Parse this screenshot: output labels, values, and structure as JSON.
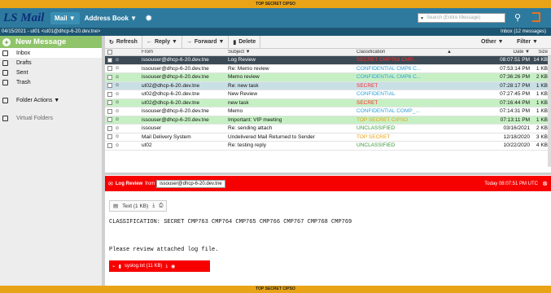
{
  "banner_top": "TOP SECRET CIPSO",
  "banner_bottom": "TOP SECRET CIPSO",
  "app_logo": "LS Mail",
  "nav": {
    "mail": "Mail ▼",
    "address_book": "Address Book ▼"
  },
  "search_placeholder": "Search (Entire Message)",
  "user_bar": {
    "left": "04/15/2021 - ut01 <ut01@dhcp-6-20.dev.tne>",
    "right": "Inbox (12 messages)"
  },
  "sidebar": {
    "new_message": "New Message",
    "folders": [
      "Inbox",
      "Drafts",
      "Sent",
      "Trash"
    ],
    "folder_actions": "Folder Actions ▼",
    "virtual_folders": "Virtual Folders"
  },
  "toolbar": {
    "refresh": "Refresh",
    "reply": "Reply ▼",
    "forward": "Forward ▼",
    "delete": "Delete",
    "other": "Other ▼",
    "filter": "Filter ▼"
  },
  "columns": {
    "from": "From",
    "subject": "Subject ▼",
    "classification": "Classification",
    "date": "Date ▼",
    "size": "Size"
  },
  "messages": [
    {
      "from": "issouser@dhcp-6-20.dev.tne",
      "subject": "Log Review",
      "classification": "SECRET CMP763 CMP...",
      "date": "08:07:51 PM",
      "size": "14 KB",
      "bg": "#3b4a55",
      "fg": "#ffffff",
      "class_color": "#ff2a2a"
    },
    {
      "from": "issouser@dhcp-6-20.dev.tne",
      "subject": "Re: Memo review",
      "classification": "CONFIDENTIAL CMP6 C...",
      "date": "07:53:14 PM",
      "size": "1 KB",
      "bg": "#ffffff",
      "fg": "#111111",
      "class_color": "#2f9fd6"
    },
    {
      "from": "issouser@dhcp-6-20.dev.tne",
      "subject": "Memo review",
      "classification": "CONFIDENTIAL CMP6 C...",
      "date": "07:36:26 PM",
      "size": "2 KB",
      "bg": "#c6f0c4",
      "fg": "#111111",
      "class_color": "#2f9fd6"
    },
    {
      "from": "ut02@dhcp-6-20.dev.tne",
      "subject": "Re: new task",
      "classification": "SECRET",
      "date": "07:28:17 PM",
      "size": "1 KB",
      "bg": "#c9dfe6",
      "fg": "#111111",
      "class_color": "#ff2a2a"
    },
    {
      "from": "ut02@dhcp-6-20.dev.tne",
      "subject": "New Review",
      "classification": "CONFIDENTIAL",
      "date": "07:27:45 PM",
      "size": "1 KB",
      "bg": "#ffffff",
      "fg": "#111111",
      "class_color": "#2f9fd6"
    },
    {
      "from": "ut02@dhcp-6-20.dev.tne",
      "subject": "new task",
      "classification": "SECRET",
      "date": "07:16:44 PM",
      "size": "1 KB",
      "bg": "#c6f0c4",
      "fg": "#111111",
      "class_color": "#ff2a2a"
    },
    {
      "from": "issouser@dhcp-6-20.dev.tne",
      "subject": "Memo",
      "classification": "CONFIDENTIAL COMP_...",
      "date": "07:14:31 PM",
      "size": "1 KB",
      "bg": "#ffffff",
      "fg": "#111111",
      "class_color": "#2f9fd6"
    },
    {
      "from": "issouser@dhcp-6-20.dev.tne",
      "subject": "Important: VIP meeting",
      "classification": "TOP SECRET CIPSO",
      "date": "07:13:11 PM",
      "size": "1 KB",
      "bg": "#c6f0c4",
      "fg": "#111111",
      "class_color": "#e8a316"
    },
    {
      "from": "issouser",
      "subject": "Re: sending attach",
      "classification": "UNCLASSIFIED",
      "date": "03/16/2021",
      "size": "2 KB",
      "bg": "#ffffff",
      "fg": "#111111",
      "class_color": "#3a9a3a"
    },
    {
      "from": "Mail Delivery System",
      "subject": "Undelivered Mail Returned to Sender",
      "classification": "TOP SECRET",
      "date": "12/18/2020",
      "size": "3 KB",
      "bg": "#ffffff",
      "fg": "#111111",
      "class_color": "#e8a316"
    },
    {
      "from": "ut02",
      "subject": "Re: testing reply",
      "classification": "UNCLASSIFIED",
      "date": "10/22/2020",
      "size": "4 KB",
      "bg": "#ffffff",
      "fg": "#111111",
      "class_color": "#3a9a3a"
    }
  ],
  "reading": {
    "subject": "Log Review",
    "from_label": "from",
    "from_address": "issouser@dhcp-6-20.dev.tne",
    "date": "Today 08:07:51 PM UTC",
    "text_attachment": "Text (1 KB)",
    "classification_line": "CLASSIFICATION: SECRET CMP763 CMP764 CMP765 CMP766 CMP767 CMP768 CMP769",
    "body": "Please review attached log file.",
    "attachment_label": "syslog.txt (11 KB)"
  }
}
